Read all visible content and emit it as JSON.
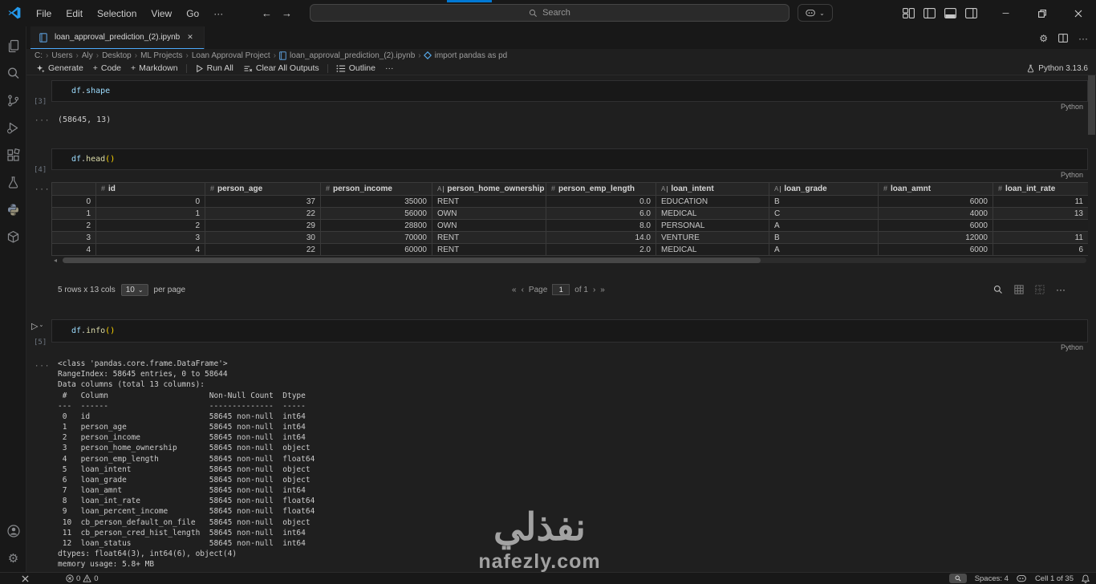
{
  "titlebar": {
    "menus": [
      "File",
      "Edit",
      "Selection",
      "View",
      "Go"
    ],
    "more": "···",
    "back": "←",
    "forward": "→",
    "search_placeholder": "Search"
  },
  "tab": {
    "title": "loan_approval_prediction_(2).ipynb",
    "close": "✕"
  },
  "breadcrumb": {
    "items": [
      "C:",
      "Users",
      "Aly",
      "Desktop",
      "ML Projects",
      "Loan Approval Project",
      "loan_approval_prediction_(2).ipynb",
      "import pandas as pd"
    ],
    "sep": "›"
  },
  "toolbar": {
    "generate": "Generate",
    "plus": "+",
    "code": "Code",
    "markdown": "Markdown",
    "run_all": "Run All",
    "clear_outputs": "Clear All Outputs",
    "outline": "Outline",
    "more": "···"
  },
  "kernel": {
    "label": "Python 3.13.6"
  },
  "cells": {
    "c1": {
      "exec": "[3]",
      "var": "df",
      "dot": ".",
      "attr": "shape",
      "lang": "Python",
      "gutter": "···",
      "output": "(58645, 13)"
    },
    "c2": {
      "exec": "[4]",
      "var": "df",
      "dot": ".",
      "attr": "head",
      "paren": "()",
      "lang": "Python",
      "gutter": "···"
    },
    "c3": {
      "exec": "[5]",
      "var": "df",
      "dot": ".",
      "attr": "info",
      "paren": "()",
      "lang": "Python",
      "gutter": "···",
      "run": "▷",
      "run_chev": "⌄",
      "output": "<class 'pandas.core.frame.DataFrame'>\nRangeIndex: 58645 entries, 0 to 58644\nData columns (total 13 columns):\n #   Column                      Non-Null Count  Dtype  \n---  ------                      --------------  -----  \n 0   id                          58645 non-null  int64  \n 1   person_age                  58645 non-null  int64  \n 2   person_income               58645 non-null  int64  \n 3   person_home_ownership       58645 non-null  object \n 4   person_emp_length           58645 non-null  float64\n 5   loan_intent                 58645 non-null  object \n 6   loan_grade                  58645 non-null  object \n 7   loan_amnt                   58645 non-null  int64  \n 8   loan_int_rate               58645 non-null  float64\n 9   loan_percent_income         58645 non-null  float64\n 10  cb_person_default_on_file   58645 non-null  object \n 11  cb_person_cred_hist_length  58645 non-null  int64  \n 12  loan_status                 58645 non-null  int64  \ndtypes: float64(3), int64(6), object(4)\nmemory usage: 5.8+ MB"
    }
  },
  "table": {
    "headers": [
      {
        "icon": "#",
        "label": "id"
      },
      {
        "icon": "#",
        "label": "person_age"
      },
      {
        "icon": "#",
        "label": "person_income"
      },
      {
        "icon": "A",
        "label": "person_home_ownership"
      },
      {
        "icon": "#",
        "label": "person_emp_length"
      },
      {
        "icon": "A",
        "label": "loan_intent"
      },
      {
        "icon": "A",
        "label": "loan_grade"
      },
      {
        "icon": "#",
        "label": "loan_amnt"
      },
      {
        "icon": "#",
        "label": "loan_int_rate"
      }
    ],
    "rows": [
      {
        "idx": "0",
        "id": "0",
        "age": "37",
        "income": "35000",
        "home": "RENT",
        "emp": "0.0",
        "intent": "EDUCATION",
        "grade": "B",
        "amnt": "6000",
        "rate": "11"
      },
      {
        "idx": "1",
        "id": "1",
        "age": "22",
        "income": "56000",
        "home": "OWN",
        "emp": "6.0",
        "intent": "MEDICAL",
        "grade": "C",
        "amnt": "4000",
        "rate": "13"
      },
      {
        "idx": "2",
        "id": "2",
        "age": "29",
        "income": "28800",
        "home": "OWN",
        "emp": "8.0",
        "intent": "PERSONAL",
        "grade": "A",
        "amnt": "6000",
        "rate": ""
      },
      {
        "idx": "3",
        "id": "3",
        "age": "30",
        "income": "70000",
        "home": "RENT",
        "emp": "14.0",
        "intent": "VENTURE",
        "grade": "B",
        "amnt": "12000",
        "rate": "11"
      },
      {
        "idx": "4",
        "id": "4",
        "age": "22",
        "income": "60000",
        "home": "RENT",
        "emp": "2.0",
        "intent": "MEDICAL",
        "grade": "A",
        "amnt": "6000",
        "rate": "6"
      }
    ],
    "summary": "5 rows x 13 cols",
    "page_size": "10",
    "per_page": "per page",
    "first": "«",
    "prev": "‹",
    "page_label": "Page",
    "page_value": "1",
    "of_label": "of 1",
    "next": "›",
    "last": "»",
    "more": "···",
    "scroll_left_arrow": "◂"
  },
  "statusbar": {
    "errors": "0",
    "warnings": "0",
    "spaces": "Spaces: 4",
    "cell_pos": "Cell 1 of 35"
  },
  "glyphs": {
    "minimize": "─",
    "gear": "⚙",
    "chevron_down": "⌄"
  },
  "watermark": {
    "line1": "نفذلي",
    "line2": "nafezly.com"
  }
}
